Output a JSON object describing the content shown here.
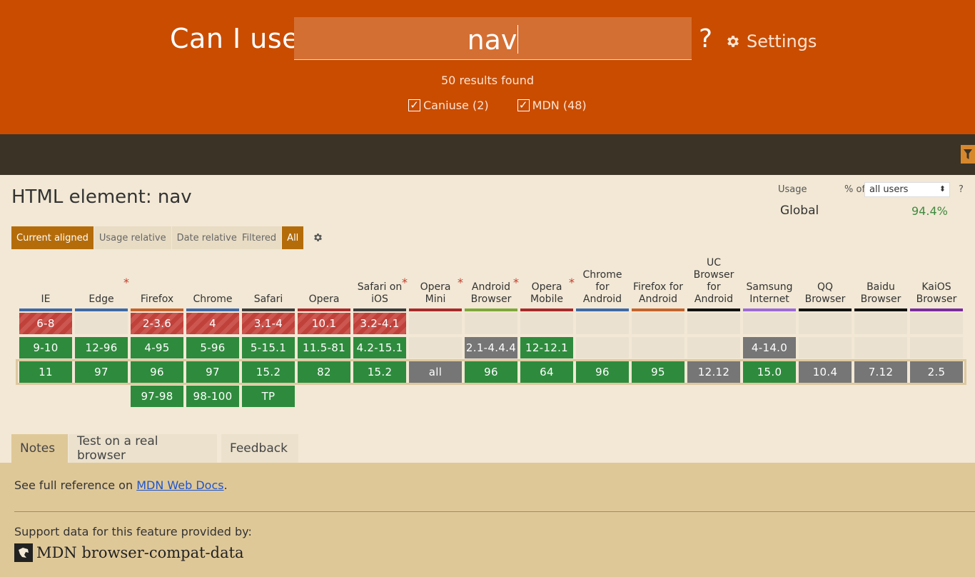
{
  "header": {
    "brand": "Can I use",
    "search_value": "nav",
    "help": "?",
    "settings_label": "Settings",
    "results_text": "50 results found",
    "filters": [
      {
        "label": "Caniuse (2)",
        "checked": true
      },
      {
        "label": "MDN (48)",
        "checked": true
      }
    ]
  },
  "feature": {
    "title": "HTML element: nav",
    "usage_label": "Usage",
    "pct_of_label": "% of",
    "users_select": "all users",
    "usage_help": "?",
    "global_label": "Global",
    "global_value": "94.4%"
  },
  "view_buttons": [
    "Current aligned",
    "Usage relative",
    "Date relative"
  ],
  "filter_buttons": [
    "Filtered",
    "All"
  ],
  "browsers": [
    {
      "name": "IE",
      "star": false,
      "color": "#3d6aa8"
    },
    {
      "name": "Edge",
      "star": true,
      "color": "#3d6aa8"
    },
    {
      "name": "Firefox",
      "star": false,
      "color": "#c4632b"
    },
    {
      "name": "Chrome",
      "star": false,
      "color": "#3d6aa8"
    },
    {
      "name": "Safari",
      "star": false,
      "color": "#3a3a3a"
    },
    {
      "name": "Opera",
      "star": false,
      "color": "#a82a2a"
    },
    {
      "name": "Safari on iOS",
      "star": true,
      "color": "#3a3a3a"
    },
    {
      "name": "Opera Mini",
      "star": true,
      "color": "#a82a2a"
    },
    {
      "name": "Android Browser",
      "star": true,
      "color": "#7ea83a"
    },
    {
      "name": "Opera Mobile",
      "star": true,
      "color": "#a82a2a"
    },
    {
      "name": "Chrome for Android",
      "star": false,
      "color": "#3d6aa8"
    },
    {
      "name": "Firefox for Android",
      "star": false,
      "color": "#c4632b"
    },
    {
      "name": "UC Browser for Android",
      "star": false,
      "color": "#111111"
    },
    {
      "name": "Samsung Internet",
      "star": false,
      "color": "#9c6ad8"
    },
    {
      "name": "QQ Browser",
      "star": false,
      "color": "#111111"
    },
    {
      "name": "Baidu Browser",
      "star": false,
      "color": "#111111"
    },
    {
      "name": "KaiOS Browser",
      "star": false,
      "color": "#7a2ba0"
    }
  ],
  "support_rows": [
    [
      [
        "6-8",
        "r"
      ],
      [
        "",
        "e"
      ],
      [
        "2-3.6",
        "r"
      ],
      [
        "4",
        "r"
      ],
      [
        "3.1-4",
        "r"
      ],
      [
        "10.1",
        "r"
      ],
      [
        "3.2-4.1",
        "r"
      ],
      [
        "",
        "e"
      ],
      [
        "",
        "e"
      ],
      [
        "",
        "e"
      ],
      [
        "",
        "e"
      ],
      [
        "",
        "e"
      ],
      [
        "",
        "e"
      ],
      [
        "",
        "e"
      ],
      [
        "",
        "e"
      ],
      [
        "",
        "e"
      ],
      [
        "",
        "e"
      ]
    ],
    [
      [
        "9-10",
        "g"
      ],
      [
        "12-96",
        "g"
      ],
      [
        "4-95",
        "g"
      ],
      [
        "5-96",
        "g"
      ],
      [
        "5-15.1",
        "g"
      ],
      [
        "11.5-81",
        "g"
      ],
      [
        "4.2-15.1",
        "g"
      ],
      [
        "",
        "e"
      ],
      [
        "2.1-4.4.4",
        "gr"
      ],
      [
        "12-12.1",
        "g"
      ],
      [
        "",
        "e"
      ],
      [
        "",
        "e"
      ],
      [
        "",
        "e"
      ],
      [
        "4-14.0",
        "gr"
      ],
      [
        "",
        "e"
      ],
      [
        "",
        "e"
      ],
      [
        "",
        "e"
      ]
    ],
    [
      [
        "11",
        "g"
      ],
      [
        "97",
        "g"
      ],
      [
        "96",
        "g"
      ],
      [
        "97",
        "g"
      ],
      [
        "15.2",
        "g"
      ],
      [
        "82",
        "g"
      ],
      [
        "15.2",
        "g"
      ],
      [
        "all",
        "gr"
      ],
      [
        "96",
        "g"
      ],
      [
        "64",
        "g"
      ],
      [
        "96",
        "g"
      ],
      [
        "95",
        "g"
      ],
      [
        "12.12",
        "gr"
      ],
      [
        "15.0",
        "g"
      ],
      [
        "10.4",
        "gr"
      ],
      [
        "7.12",
        "gr"
      ],
      [
        "2.5",
        "gr"
      ]
    ],
    [
      [
        "",
        "x"
      ],
      [
        "",
        "x"
      ],
      [
        "97-98",
        "g"
      ],
      [
        "98-100",
        "g"
      ],
      [
        "TP",
        "g"
      ],
      [
        "",
        "x"
      ],
      [
        "",
        "x"
      ],
      [
        "",
        "x"
      ],
      [
        "",
        "x"
      ],
      [
        "",
        "x"
      ],
      [
        "",
        "x"
      ],
      [
        "",
        "x"
      ],
      [
        "",
        "x"
      ],
      [
        "",
        "x"
      ],
      [
        "",
        "x"
      ],
      [
        "",
        "x"
      ],
      [
        "",
        "x"
      ]
    ]
  ],
  "tabs": [
    "Notes",
    "Test on a real browser",
    "Feedback"
  ],
  "notes": {
    "prefix": "See full reference on ",
    "link": "MDN Web Docs",
    "suffix": ".",
    "support_text": "Support data for this feature provided by:",
    "source": "MDN browser-compat-data"
  },
  "colors": {
    "header": "#c94c00",
    "supported": "#2e8b3d",
    "unsupported": "#c0403a",
    "unknown": "#767676",
    "accent": "#b46c0a"
  }
}
